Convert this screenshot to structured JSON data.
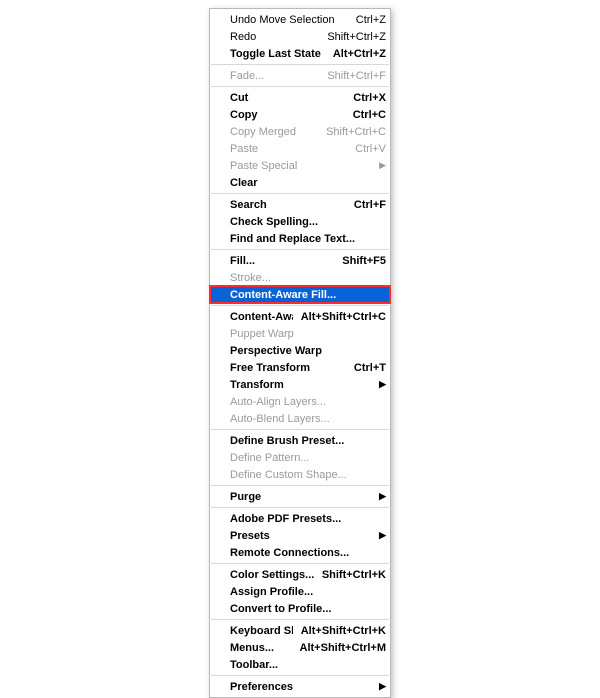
{
  "menu": {
    "groups": [
      [
        {
          "label": "Undo Move Selection",
          "shortcut": "Ctrl+Z"
        },
        {
          "label": "Redo",
          "shortcut": "Shift+Ctrl+Z"
        },
        {
          "label": "Toggle Last State",
          "shortcut": "Alt+Ctrl+Z",
          "bold": true
        }
      ],
      [
        {
          "label": "Fade...",
          "shortcut": "Shift+Ctrl+F",
          "disabled": true
        }
      ],
      [
        {
          "label": "Cut",
          "shortcut": "Ctrl+X",
          "bold": true
        },
        {
          "label": "Copy",
          "shortcut": "Ctrl+C",
          "bold": true
        },
        {
          "label": "Copy Merged",
          "shortcut": "Shift+Ctrl+C",
          "disabled": true
        },
        {
          "label": "Paste",
          "shortcut": "Ctrl+V",
          "disabled": true
        },
        {
          "label": "Paste Special",
          "submenu": true,
          "disabled": true
        },
        {
          "label": "Clear",
          "bold": true
        }
      ],
      [
        {
          "label": "Search",
          "shortcut": "Ctrl+F",
          "bold": true
        },
        {
          "label": "Check Spelling...",
          "bold": true
        },
        {
          "label": "Find and Replace Text...",
          "bold": true
        }
      ],
      [
        {
          "label": "Fill...",
          "shortcut": "Shift+F5",
          "bold": true
        },
        {
          "label": "Stroke...",
          "disabled": true
        },
        {
          "label": "Content-Aware Fill...",
          "selected": true,
          "highlight": true,
          "bold": true
        }
      ],
      [
        {
          "label": "Content-Aware Scale",
          "shortcut": "Alt+Shift+Ctrl+C",
          "bold": true
        },
        {
          "label": "Puppet Warp",
          "disabled": true
        },
        {
          "label": "Perspective Warp",
          "bold": true
        },
        {
          "label": "Free Transform",
          "shortcut": "Ctrl+T",
          "bold": true
        },
        {
          "label": "Transform",
          "submenu": true,
          "bold": true
        },
        {
          "label": "Auto-Align Layers...",
          "disabled": true
        },
        {
          "label": "Auto-Blend Layers...",
          "disabled": true
        }
      ],
      [
        {
          "label": "Define Brush Preset...",
          "bold": true
        },
        {
          "label": "Define Pattern...",
          "disabled": true
        },
        {
          "label": "Define Custom Shape...",
          "disabled": true
        }
      ],
      [
        {
          "label": "Purge",
          "submenu": true,
          "bold": true
        }
      ],
      [
        {
          "label": "Adobe PDF Presets...",
          "bold": true
        },
        {
          "label": "Presets",
          "submenu": true,
          "bold": true
        },
        {
          "label": "Remote Connections...",
          "bold": true
        }
      ],
      [
        {
          "label": "Color Settings...",
          "shortcut": "Shift+Ctrl+K",
          "bold": true
        },
        {
          "label": "Assign Profile...",
          "bold": true
        },
        {
          "label": "Convert to Profile...",
          "bold": true
        }
      ],
      [
        {
          "label": "Keyboard Shortcuts...",
          "shortcut": "Alt+Shift+Ctrl+K",
          "bold": true
        },
        {
          "label": "Menus...",
          "shortcut": "Alt+Shift+Ctrl+M",
          "bold": true
        },
        {
          "label": "Toolbar...",
          "bold": true
        }
      ],
      [
        {
          "label": "Preferences",
          "submenu": true,
          "bold": true
        }
      ]
    ],
    "arrow_glyph": "▶"
  }
}
